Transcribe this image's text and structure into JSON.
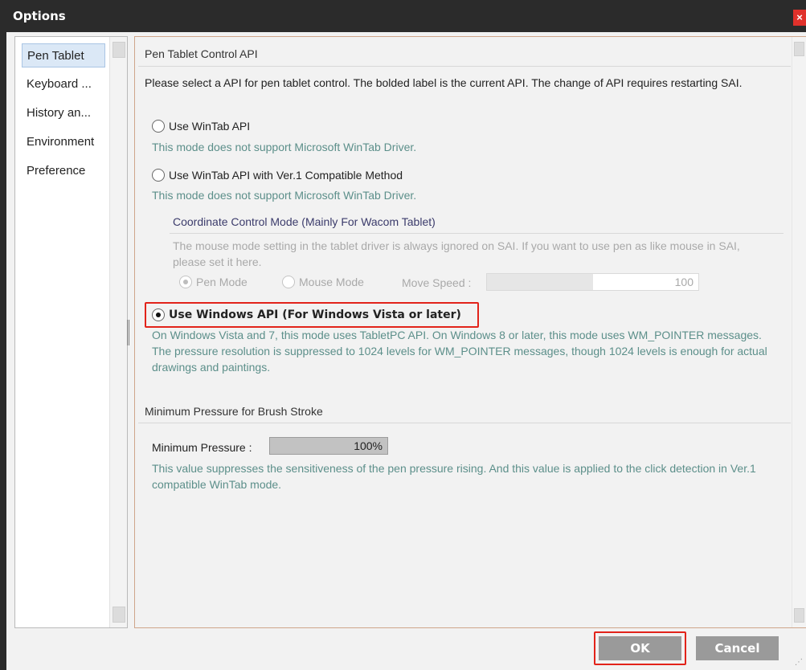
{
  "window": {
    "title": "Options",
    "close_glyph": "×"
  },
  "sidebar": {
    "items": [
      {
        "label": "Pen Tablet",
        "active": true
      },
      {
        "label": "Keyboard ..."
      },
      {
        "label": "History an..."
      },
      {
        "label": "Environment"
      },
      {
        "label": "Preference"
      }
    ]
  },
  "pen_api": {
    "section_title": "Pen Tablet Control API",
    "description": "Please select a API for pen tablet control. The bolded label is the current API. The change of API requires restarting SAI.",
    "options": [
      {
        "label": "Use WinTab API",
        "note": "This mode does not support Microsoft WinTab Driver.",
        "selected": false
      },
      {
        "label": "Use WinTab API with Ver.1 Compatible Method",
        "note": "This mode does not support Microsoft WinTab Driver.",
        "selected": false
      },
      {
        "label": "Use Windows API (For Windows Vista or later)",
        "note": "On Windows Vista and 7, this mode uses TabletPC API. On Windows 8 or later, this mode uses WM_POINTER messages. The pressure resolution is suppressed to 1024 levels for WM_POINTER messages, though 1024 levels is enough for actual drawings and paintings.",
        "selected": true
      }
    ],
    "coordinate": {
      "title": "Coordinate Control Mode (Mainly For Wacom Tablet)",
      "description": "The mouse mode setting in the tablet driver is always ignored on SAI. If you want to use pen as like mouse in SAI, please set it here.",
      "pen_mode": "Pen Mode",
      "mouse_mode": "Mouse Mode",
      "move_speed_label": "Move Speed :",
      "move_speed_value": "100",
      "move_speed_fraction": 0.5
    }
  },
  "pressure": {
    "section_title": "Minimum Pressure for Brush Stroke",
    "label": "Minimum Pressure :",
    "value": "100%",
    "fraction": 1.0,
    "note": "This value suppresses the sensitiveness of the pen pressure rising. And this value is applied to the click detection in Ver.1 compatible WinTab mode."
  },
  "buttons": {
    "ok": "OK",
    "cancel": "Cancel"
  },
  "colors": {
    "accent_red": "#e2231a",
    "note_teal": "#5c8f8a",
    "button_gray": "#9a9a9a"
  }
}
